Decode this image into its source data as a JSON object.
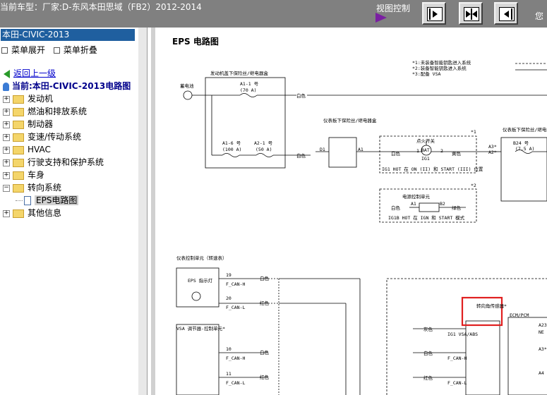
{
  "header": {
    "car_model": "当前车型：厂家:D-东风本田思域（FB2）2012-2014",
    "view_control": "视图控制",
    "right_cut_text": "您"
  },
  "sidebar": {
    "title": "本田-CIVIC-2013",
    "expand_label": "菜单展开",
    "collapse_label": "菜单折叠",
    "back_label": "返回上一级",
    "current_label": "当前:本田-CIVIC-2013电路图",
    "items": [
      {
        "label": "发动机"
      },
      {
        "label": "燃油和排放系统"
      },
      {
        "label": "制动器"
      },
      {
        "label": "变速/传动系统"
      },
      {
        "label": "HVAC"
      },
      {
        "label": "行驶支持和保护系统"
      },
      {
        "label": "车身"
      },
      {
        "label": "转向系统"
      }
    ],
    "subitem": "EPS电路图",
    "last_item": "其他信息"
  },
  "diagram": {
    "title": "EPS 电路图",
    "battery": "蓄电池",
    "engine_box": "发动机盖下保险丝/继电器盒",
    "fuse_a1_1": "A1-1 号",
    "fuse_a1_1_amp": "(70 A)",
    "fuse_a1_6": "A1-6 号",
    "fuse_a1_6_amp": "(100 A)",
    "fuse_a2_1": "A2-1 号",
    "fuse_a2_1_amp": "(50 A)",
    "white": "白色",
    "red": "红色",
    "yellow": "黄色",
    "green": "绿色",
    "gray": "灰色",
    "dash_box": "仪表板下保险丝/继电器盒",
    "d1": "D1",
    "a1": "A1",
    "ign_switch": "点火开关",
    "bat": "BAT",
    "ig1": "IG1",
    "pin1": "1",
    "pin2": "2",
    "ign_note": "IG1 HOT 在 ON (II) 和 START (III) 位置",
    "note1": "*1:未装备智能钥匙进入系统",
    "note2": "*2:装备智能钥匙进入系统",
    "note3": "*3:配备 VSA",
    "star1": "*1",
    "star2": "*2",
    "pcu": "电源控制单元",
    "b2": "B2",
    "igb_note": "IG1B HOT 在 IGN 和 START 模式",
    "dash_box2": "仪表板下保险丝/继电器盒",
    "a3": "A3*",
    "a2": "A2*",
    "b24": "B24 号",
    "b24_amp": "(7.5 A)",
    "cluster": "仪表控制单元（转速表）",
    "eps_lamp": "EPS 指示灯",
    "p19": "19",
    "p20": "20",
    "fcan_h": "F_CAN-H",
    "fcan_l": "F_CAN-L",
    "vsa": "VSA 调节器-控制单元*",
    "p10": "10",
    "p11": "11",
    "steer_sensor": "转向角传感器*",
    "ig1_vsa": "IG1 VSA/ABS",
    "ecm": "ECM/PCM",
    "a4": "A4",
    "a23": "A23",
    "ne": "NE"
  }
}
